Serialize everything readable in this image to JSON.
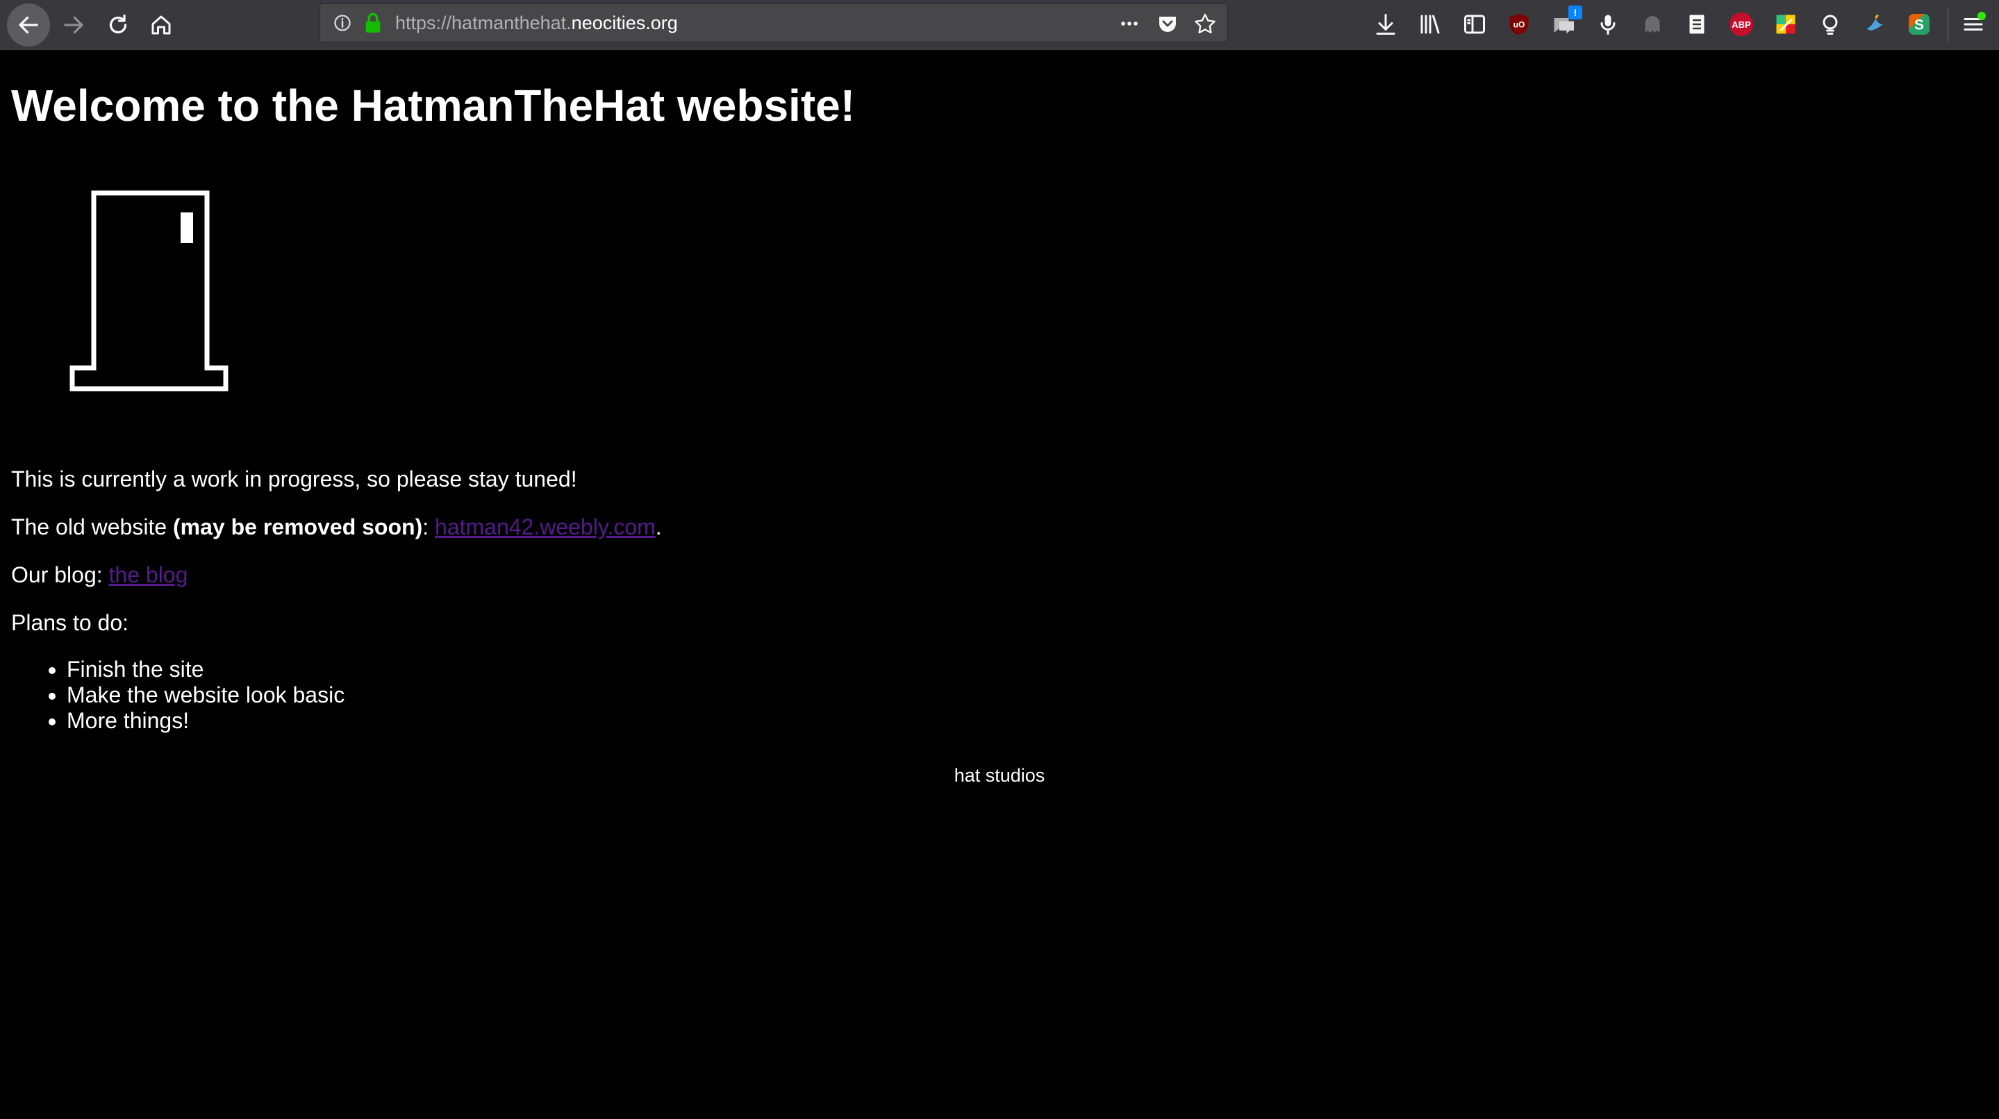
{
  "browser": {
    "url_scheme": "https://hatmanthehat.",
    "url_host": "neocities.org",
    "extensions": {
      "abp_label": "ABP",
      "notification_count": "!"
    }
  },
  "page": {
    "title": "Welcome to the HatmanTheHat website!",
    "wip_text": "This is currently a work in progress, so please stay tuned!",
    "old_site_prefix": "The old website ",
    "old_site_bold": "(may be removed soon)",
    "old_site_colon": ": ",
    "old_site_link": "hatman42.weebly.com",
    "old_site_suffix": ".",
    "blog_prefix": "Our blog: ",
    "blog_link": "the blog",
    "plans_label": "Plans to do:",
    "plans": [
      "Finish the site",
      "Make the website look basic",
      "More things!"
    ],
    "footer": "hat studios"
  },
  "colors": {
    "background": "#000000",
    "text": "#ffffff",
    "link_visited": "#551a8b",
    "toolbar": "#38383d"
  }
}
